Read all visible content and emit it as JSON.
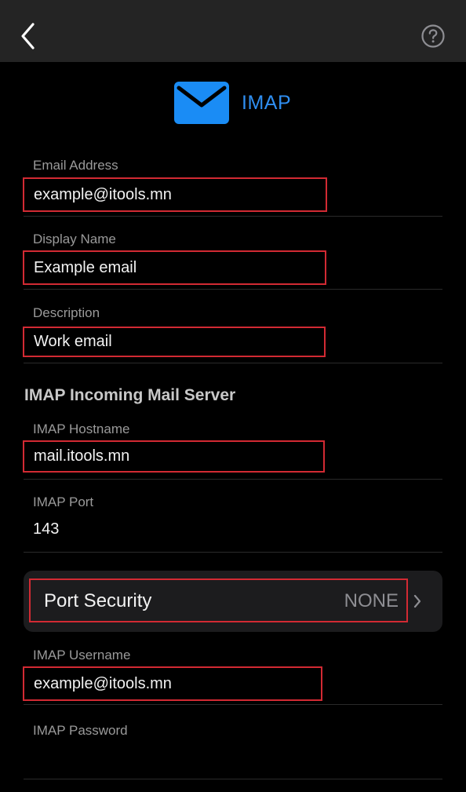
{
  "header": {
    "title": "IMAP"
  },
  "fields": {
    "email_address": {
      "label": "Email Address",
      "value": "example@itools.mn"
    },
    "display_name": {
      "label": "Display Name",
      "value": "Example email"
    },
    "description": {
      "label": "Description",
      "value": "Work email"
    },
    "imap_hostname": {
      "label": "IMAP Hostname",
      "value": "mail.itools.mn"
    },
    "imap_port": {
      "label": "IMAP Port",
      "value": "143"
    },
    "imap_username": {
      "label": "IMAP Username",
      "value": "example@itools.mn"
    },
    "imap_password": {
      "label": "IMAP Password",
      "value": ""
    }
  },
  "section": {
    "incoming_title": "IMAP Incoming Mail Server"
  },
  "port_security": {
    "label": "Port Security",
    "value": "NONE"
  },
  "icons": {
    "back": "chevron-left-icon",
    "help": "question-circle-icon",
    "mail": "envelope-icon",
    "disclosure": "chevron-right-icon"
  },
  "colors": {
    "accent": "#2f8ef0",
    "highlight": "#d22a33",
    "topbar": "#242424",
    "mail_icon_bg": "#1a8cf5"
  }
}
